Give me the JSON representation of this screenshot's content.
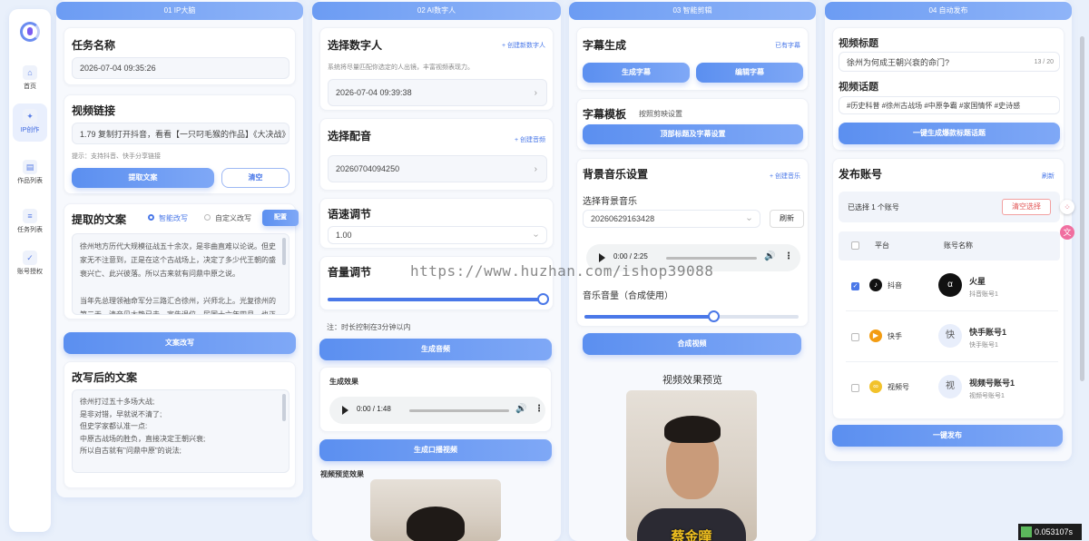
{
  "sidebar": {
    "items": [
      {
        "label": "首页",
        "icon": "⌂"
      },
      {
        "label": "IP创作",
        "icon": "✦"
      },
      {
        "label": "作品列表",
        "icon": "▤"
      },
      {
        "label": "任务列表",
        "icon": "≡"
      },
      {
        "label": "账号授权",
        "icon": "✓"
      }
    ]
  },
  "col1": {
    "header": "01 IP大脑",
    "task_title": "任务名称",
    "task_value": "2026-07-04 09:35:26",
    "video_link_title": "视频链接",
    "video_link_value": "1.79 复制打开抖音，看看【一只叼毛猴的作品】《大决战》三部",
    "hint": "提示：支持抖音、快手分享链接",
    "extract_btn": "提取文案",
    "clear_btn": "清空",
    "extracted_title": "提取的文案",
    "mode_smart": "智能改写",
    "mode_custom": "自定义改写",
    "config_btn": "配置",
    "extracted_text": "徐州地方历代大规模征战五十余次，是非曲直难以论说。但史家无不注意到，正是在这个古战场上，决定了多少代王朝的盛衰兴亡、此兴彼落。所以古来就有问鼎中原之说。\n\n当年先总理领袖命军分三路汇合徐州，兴师北上。光复徐州的第二天，清帝见大势已去，宣告退位。民国十六年四月，也正",
    "rewrite_btn": "文案改写",
    "rewritten_title": "改写后的文案",
    "rewritten_text": "徐州打过五十多场大战;\n是非对错，早就说不清了;\n但史学家都认准一点:\n中原古战场的胜负，直接决定王朝兴衰;\n所以自古就有\"问鼎中原\"的说法;"
  },
  "col2": {
    "header": "02 AI数字人",
    "avatar_title": "选择数字人",
    "create_avatar": "+ 创建新数字人",
    "avatar_desc": "系统将尽量匹配你选定的人出镜，丰富视频表现力。",
    "avatar_value": "2026-07-04 09:39:38",
    "voice_title": "选择配音",
    "create_voice": "+ 创建音频",
    "voice_value": "20260704094250",
    "speed_title": "语速调节",
    "speed_value": "1.00",
    "volume_title": "音量调节",
    "volume_level": 0.97,
    "note": "注：时长控制在3分钟以内",
    "gen_audio_btn": "生成音频",
    "effect_title": "生成效果",
    "audio_time": "0:00 / 1:48",
    "gen_video_btn": "生成口播视频",
    "preview_title": "视频预览效果"
  },
  "col3": {
    "header": "03 智能剪辑",
    "subtitle_title": "字幕生成",
    "subtitle_status": "已有字幕",
    "gen_sub_btn": "生成字幕",
    "edit_sub_btn": "编辑字幕",
    "template_title": "字幕模板",
    "template_sub": "按照剪映设置",
    "template_btn": "顶部标题及字幕设置",
    "bgm_title": "背景音乐设置",
    "create_music": "+ 创建音乐",
    "choose_bgm": "选择背景音乐",
    "bgm_value": "20260629163428",
    "refresh_btn": "刷新",
    "bgm_time": "0:00 / 2:25",
    "music_vol_title": "音乐音量（合成使用）",
    "music_vol_level": 0.6,
    "compose_btn": "合成视频",
    "preview_title": "视频效果预览",
    "subtitle_overlay": "蔡金曈"
  },
  "col4": {
    "header": "04 自动发布",
    "vtitle_label": "视频标题",
    "vtitle_value": "徐州为何成王朝兴衰的命门?",
    "vtitle_count": "13 / 20",
    "topic_label": "视频话题",
    "topic_value": "#历史科普 #徐州古战场 #中原争霸 #家国情怀 #史诗感",
    "gen_btn": "一键生成爆款标题话题",
    "account_title": "发布账号",
    "refresh": "刷新",
    "selected_text": "已选择 1 个账号",
    "clear_select": "清空选择",
    "col_platform": "平台",
    "col_account": "账号名称",
    "rows": [
      {
        "platform": "抖音",
        "name": "火星",
        "sub": "抖音账号1",
        "checked": true,
        "avatar": "α"
      },
      {
        "platform": "快手",
        "name": "快手账号1",
        "sub": "快手账号1",
        "checked": false,
        "avatar": "快"
      },
      {
        "platform": "视频号",
        "name": "视频号账号1",
        "sub": "视频号账号1",
        "checked": false,
        "avatar": "视"
      }
    ],
    "publish_btn": "一键发布"
  },
  "watermark": "https://www.huzhan.com/ishop39088",
  "timer": "0.053107s",
  "colors": {
    "accent": "#4a78e8",
    "bg": "#e9f0fb"
  }
}
